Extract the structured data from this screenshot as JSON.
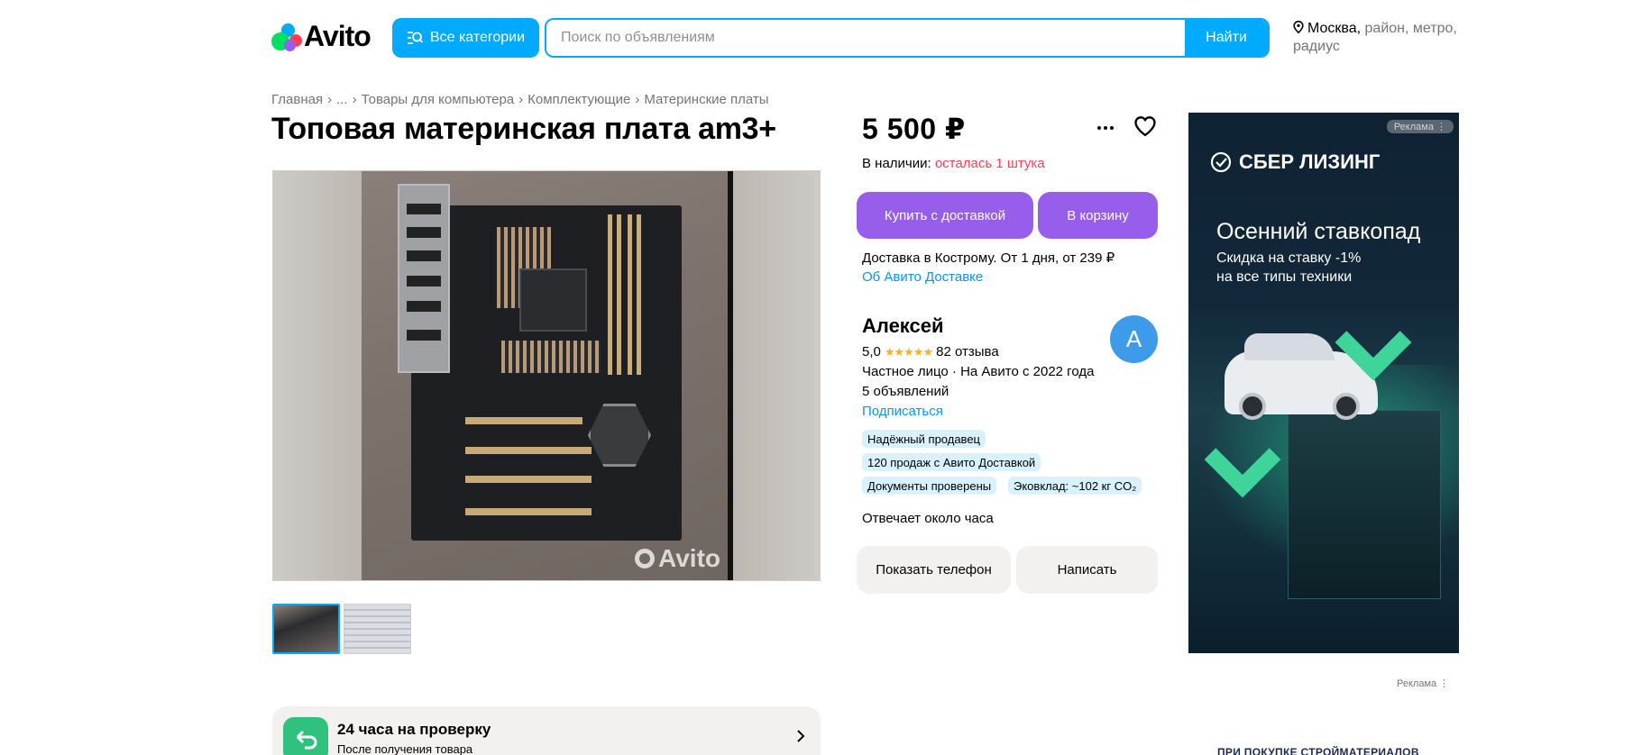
{
  "header": {
    "logo_text": "Avito",
    "categories_label": "Все категории",
    "search_placeholder": "Поиск по объявлениям",
    "search_value": "",
    "search_button": "Найти",
    "location_city": "Москва,",
    "location_rest": " район, метро, радиус"
  },
  "breadcrumbs": [
    "Главная",
    "...",
    "Товары для компьютера",
    "Комплектующие",
    "Материнские платы"
  ],
  "listing": {
    "title": "Топовая материнская плата am3+",
    "price": "5 500 ₽",
    "stock_label": "В наличии:",
    "stock_value": "осталась 1 штука",
    "buy_button": "Купить с доставкой",
    "cart_button": "В корзину",
    "delivery_text": "Доставка в Кострому. От 1 дня, от 239 ₽",
    "delivery_link": "Об Авито Доставке",
    "photo_watermark": "Avito"
  },
  "seller": {
    "name": "Алексей",
    "avatar_letter": "А",
    "rating": "5,0",
    "stars": "★★★★★",
    "reviews": "82 отзыва",
    "meta": "Частное лицо · На Авито с 2022 года",
    "ads_count": "5 объявлений",
    "subscribe": "Подписаться",
    "badges": [
      "Надёжный продавец",
      "120 продаж с Авито Доставкой",
      "Документы проверены",
      "Эковклад: ~102 кг CO₂"
    ],
    "reply_time": "Отвечает около часа",
    "phone_button": "Показать телефон",
    "message_button": "Написать"
  },
  "check_banner": {
    "title": "24 часа на проверку",
    "subtitle": "После получения товара"
  },
  "ad": {
    "label": "Реклама ⋮",
    "brand": "СБЕР ЛИЗИНГ",
    "headline": "Осенний ставкопад",
    "sub_line1": "Скидка на ставку -1%",
    "sub_line2": "на все типы техники"
  },
  "ad2": {
    "label": "Реклама ⋮",
    "text": "ПРИ ПОКУПКЕ СТРОЙМАТЕРИАЛОВ"
  },
  "colors": {
    "brand_blue": "#00aaff",
    "violet": "#965eeb",
    "link": "#0099f7",
    "warn": "#ff4053",
    "star": "#ffb021"
  }
}
